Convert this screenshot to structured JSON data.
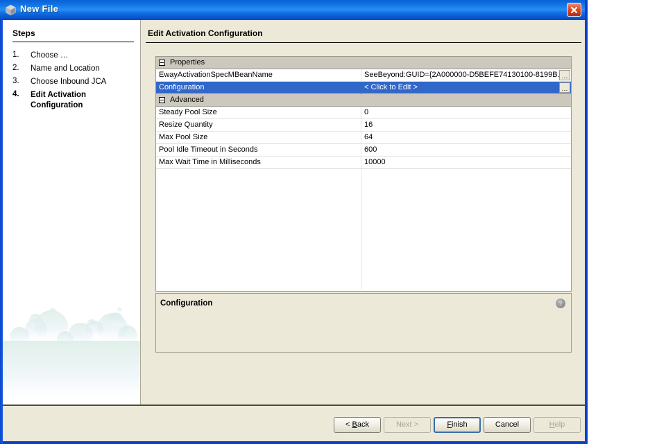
{
  "window": {
    "title": "New File",
    "icon": "cube-icon",
    "close_label": "close-icon",
    "accent_blue": "#0a46d2",
    "face_color": "#ece9d8",
    "selection_blue": "#3167c8"
  },
  "sidebar": {
    "heading": "Steps",
    "steps": [
      {
        "num": "1.",
        "label": "Choose …",
        "current": false
      },
      {
        "num": "2.",
        "label": "Name and Location",
        "current": false
      },
      {
        "num": "3.",
        "label": "Choose Inbound JCA",
        "current": false
      },
      {
        "num": "4.",
        "label": "Edit Activation Configuration",
        "current": true
      }
    ]
  },
  "content": {
    "title": "Edit Activation Configuration"
  },
  "properties_table": {
    "rows": [
      {
        "kind": "group",
        "name": "Properties",
        "value": "",
        "expander": "minus-box-icon",
        "selected": false,
        "browse": false
      },
      {
        "kind": "data",
        "name": "EwayActivationSpecMBeanName",
        "value": "SeeBeyond:GUID={2A000000-D5BEFE74130100-8199B…",
        "selected": false,
        "browse": true
      },
      {
        "kind": "data",
        "name": "Configuration",
        "value": "< Click to Edit >",
        "selected": true,
        "browse": true
      },
      {
        "kind": "group",
        "name": "Advanced",
        "value": "",
        "expander": "minus-box-icon",
        "selected": false,
        "browse": false
      },
      {
        "kind": "data",
        "name": "Steady Pool Size",
        "value": "0",
        "selected": false,
        "browse": false
      },
      {
        "kind": "data",
        "name": "Resize Quantity",
        "value": "16",
        "selected": false,
        "browse": false
      },
      {
        "kind": "data",
        "name": "Max Pool Size",
        "value": "64",
        "selected": false,
        "browse": false
      },
      {
        "kind": "data",
        "name": "Pool Idle Timeout in Seconds",
        "value": "600",
        "selected": false,
        "browse": false
      },
      {
        "kind": "data",
        "name": "Max Wait Time in Milliseconds",
        "value": "10000",
        "selected": false,
        "browse": false
      }
    ],
    "browse_button_label": "…"
  },
  "description": {
    "title": "Configuration",
    "body": "",
    "help_icon": "question-mark-icon",
    "help_glyph": "?"
  },
  "buttons": [
    {
      "id": "back",
      "label": "< Back",
      "mnemonic": "B",
      "state": "enabled",
      "default": false
    },
    {
      "id": "next",
      "label": "Next >",
      "mnemonic": "",
      "state": "disabled",
      "default": false
    },
    {
      "id": "finish",
      "label": "Finish",
      "mnemonic": "F",
      "state": "enabled",
      "default": true
    },
    {
      "id": "cancel",
      "label": "Cancel",
      "mnemonic": "",
      "state": "enabled",
      "default": false
    },
    {
      "id": "help",
      "label": "Help",
      "mnemonic": "H",
      "state": "disabled",
      "default": false
    }
  ]
}
